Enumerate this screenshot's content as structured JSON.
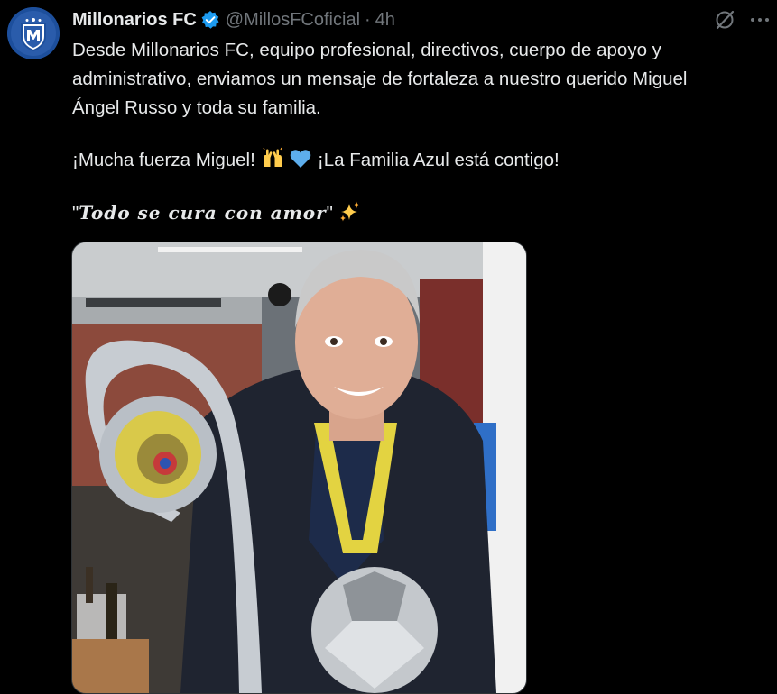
{
  "tweet": {
    "author": {
      "display_name": "Millonarios FC",
      "handle": "@MillosFCoficial",
      "verified": true,
      "avatar_icon": "millonarios-crest"
    },
    "separator": "·",
    "timestamp": "4h",
    "header_icons": [
      "grok-icon",
      "more-options-icon"
    ],
    "text": {
      "line1": "Desde Millonarios FC, equipo profesional, directivos, cuerpo de apoyo y",
      "line2": "administrativo, enviamos un mensaje de fortaleza a nuestro querido Miguel",
      "line3": "Ángel Russo y toda su familia.",
      "line4_start": "¡Mucha fuerza Miguel!",
      "line4_end": "¡La Familia Azul está contigo!",
      "quote_open": "\"",
      "quote_text": "Todo se cura con amor",
      "quote_close": "\""
    },
    "emojis": [
      "raising-hands",
      "blue-heart",
      "sparkles"
    ],
    "media": {
      "type": "photo",
      "description_icon": "photo-coach-with-trophy"
    }
  },
  "colors": {
    "background": "#000000",
    "text_primary": "#e7e9ea",
    "text_secondary": "#71767b",
    "verified_badge": "#1d9bf0",
    "brand_blue": "#1d4f9c"
  }
}
